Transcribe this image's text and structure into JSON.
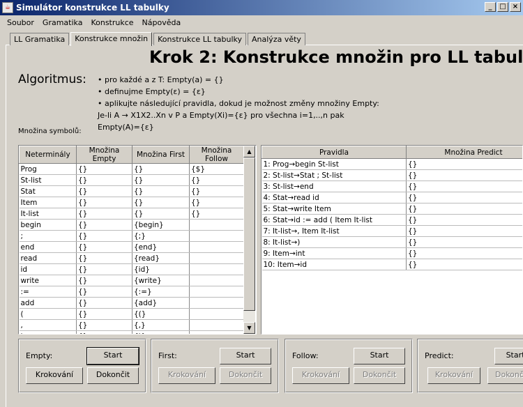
{
  "window": {
    "title": "Simulátor konstrukce LL tabulky",
    "minimize": "_",
    "maximize": "□",
    "close": "×"
  },
  "menu": [
    "Soubor",
    "Gramatika",
    "Konstrukce",
    "Nápověda"
  ],
  "tabs": [
    "LL Gramatika",
    "Konstrukce množin",
    "Konstrukce LL tabulky",
    "Analýza věty"
  ],
  "heading": "Krok 2: Konstrukce množin pro LL tabulku",
  "algorithm": {
    "label": "Algoritmus:",
    "lines": [
      "• pro každé a z T: Empty(a) = {}",
      "• definujme Empty(ε) = {ε}",
      "• aplikujte následující pravidla, dokud je možnost změny množiny Empty:",
      "Je-li A → X1X2..Xn v P a Empty(Xi)={ε} pro všechna i=1,..,n pak",
      "Empty(A)={ε}"
    ]
  },
  "symbol_set_label": "Množina symbolů:",
  "symbols_table": {
    "headers": [
      "Neterminály",
      "Množina Empty",
      "Množina First",
      "Množina Follow"
    ],
    "rows": [
      [
        "Prog",
        "{}",
        "{}",
        "{$}"
      ],
      [
        "St-list",
        "{}",
        "{}",
        "{}"
      ],
      [
        "Stat",
        "{}",
        "{}",
        "{}"
      ],
      [
        "Item",
        "{}",
        "{}",
        "{}"
      ],
      [
        "It-list",
        "{}",
        "{}",
        "{}"
      ],
      [
        "begin",
        "{}",
        "{begin}",
        ""
      ],
      [
        ";",
        "{}",
        "{;}",
        ""
      ],
      [
        "end",
        "{}",
        "{end}",
        ""
      ],
      [
        "read",
        "{}",
        "{read}",
        ""
      ],
      [
        "id",
        "{}",
        "{id}",
        ""
      ],
      [
        "write",
        "{}",
        "{write}",
        ""
      ],
      [
        ":=",
        "{}",
        "{:=}",
        ""
      ],
      [
        "add",
        "{}",
        "{add}",
        ""
      ],
      [
        "(",
        "{}",
        "{(}",
        ""
      ],
      [
        ",",
        "{}",
        "{,}",
        ""
      ],
      [
        ")",
        "{}",
        "{)}",
        ""
      ]
    ]
  },
  "rules_table": {
    "headers": [
      "Pravidla",
      "Množina Predict"
    ],
    "rows": [
      [
        "1: Prog→begin St-list",
        "{}"
      ],
      [
        "2: St-list→Stat ; St-list",
        "{}"
      ],
      [
        "3: St-list→end",
        "{}"
      ],
      [
        "4: Stat→read id",
        "{}"
      ],
      [
        "5: Stat→write Item",
        "{}"
      ],
      [
        "6: Stat→id := add ( Item It-list",
        "{}"
      ],
      [
        "7: It-list→, Item It-list",
        "{}"
      ],
      [
        "8: It-list→)",
        "{}"
      ],
      [
        "9: Item→int",
        "{}"
      ],
      [
        "10: Item→id",
        "{}"
      ]
    ]
  },
  "groups": [
    {
      "label": "Empty:",
      "start": "Start",
      "step": "Krokování",
      "finish": "Dokončit"
    },
    {
      "label": "First:",
      "start": "Start",
      "step": "Krokování",
      "finish": "Dokončit"
    },
    {
      "label": "Follow:",
      "start": "Start",
      "step": "Krokování",
      "finish": "Dokončit"
    },
    {
      "label": "Predict:",
      "start": "Start",
      "step": "Krokování",
      "finish": "Dokonč"
    }
  ]
}
